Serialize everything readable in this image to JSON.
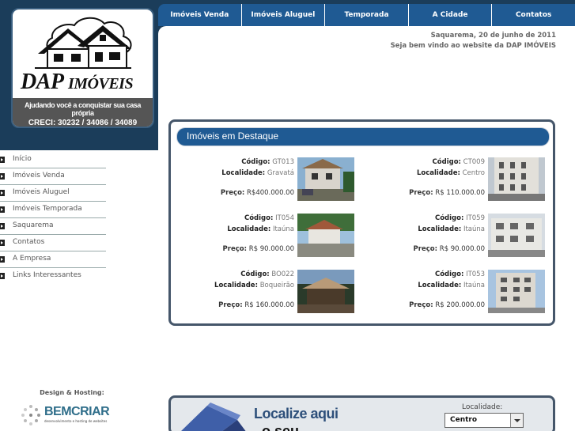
{
  "logo": {
    "name_big": "DAP",
    "name_small": "IMÓVEIS",
    "tagline": "Ajudando você a conquistar sua casa própria",
    "creci": "CRECI: 30232 / 34086 / 34089"
  },
  "nav": [
    "Imóveis Venda",
    "Imóveis Aluguel",
    "Temporada",
    "A Cidade",
    "Contatos"
  ],
  "header": {
    "date": "Saquarema, 20 de junho de 2011",
    "welcome": "Seja bem vindo ao website da DAP IMÓVEIS"
  },
  "menu": [
    "Início",
    "Imóveis Venda",
    "Imóveis Aluguel",
    "Imóveis Temporada",
    "Saquarema",
    "Contatos",
    "A Empresa",
    "Links Interessantes"
  ],
  "design": {
    "label": "Design & Hosting:",
    "brand": "BEMCRIAR",
    "sub": "desenvolvimento e hosting de websites"
  },
  "featured": {
    "title": "Imóveis em Destaque",
    "code_label": "Código:",
    "loc_label": "Localidade:",
    "price_label": "Preço:",
    "items": [
      {
        "code": "GT013",
        "loc": "Gravatá",
        "price": "R$400.000.00"
      },
      {
        "code": "CT009",
        "loc": "Centro",
        "price": "R$ 110.000.00"
      },
      {
        "code": "IT054",
        "loc": "Itaúna",
        "price": "R$ 90.000.00"
      },
      {
        "code": "IT059",
        "loc": "Itaúna",
        "price": "R$ 90.000.00"
      },
      {
        "code": "BO022",
        "loc": "Boqueirão",
        "price": "R$ 160.000.00"
      },
      {
        "code": "IT053",
        "loc": "Itaúna",
        "price": "R$ 200.000.00"
      }
    ]
  },
  "localize": {
    "title": "Localize aqui",
    "title2": "o seu",
    "label": "Localidade:",
    "selected": "Centro"
  },
  "colors": {
    "bg": "#1b3d5a",
    "nav": "#1f5a93",
    "banner": "#1f5a93"
  }
}
